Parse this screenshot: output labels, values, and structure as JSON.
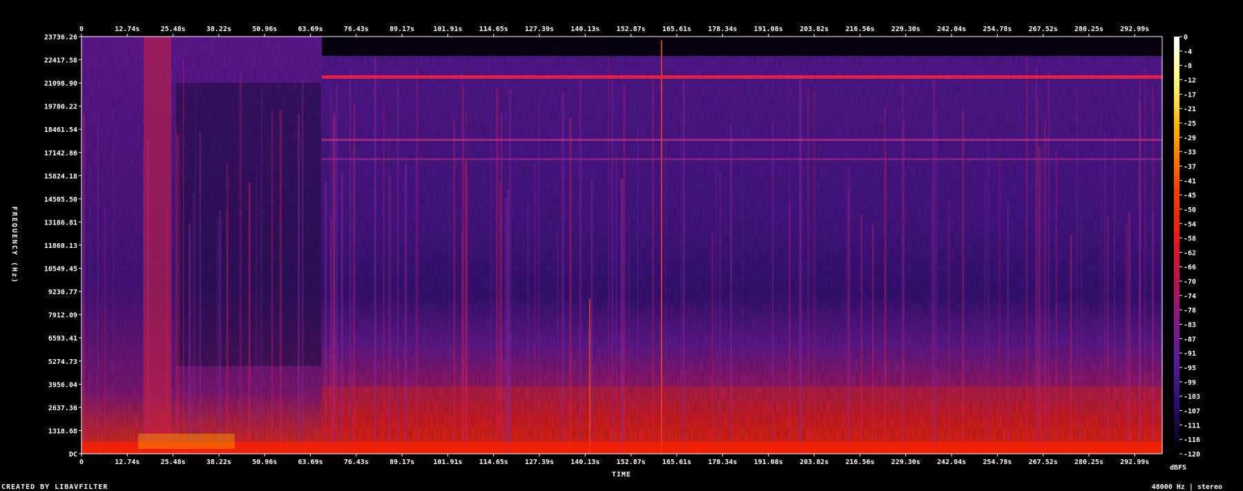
{
  "chart_data": {
    "type": "heatmap",
    "title": "",
    "xlabel": "TIME",
    "ylabel": "FREQUENCY (Hz)",
    "x_ticks": [
      "0",
      "12.74s",
      "25.48s",
      "38.22s",
      "50.96s",
      "63.69s",
      "76.43s",
      "89.17s",
      "101.91s",
      "114.65s",
      "127.39s",
      "140.13s",
      "152.87s",
      "165.61s",
      "178.34s",
      "191.08s",
      "203.82s",
      "216.56s",
      "229.30s",
      "242.04s",
      "254.78s",
      "267.52s",
      "280.25s",
      "292.99s"
    ],
    "y_ticks": [
      "23736.26",
      "22417.58",
      "21098.90",
      "19780.22",
      "18461.54",
      "17142.86",
      "15824.18",
      "14505.50",
      "13186.81",
      "11868.13",
      "10549.45",
      "9230.77",
      "7912.09",
      "6593.41",
      "5274.73",
      "3956.04",
      "2637.36",
      "1318.68",
      "DC"
    ],
    "colorbar_label": "dBFS",
    "colorbar_ticks": [
      "0",
      "-4",
      "-8",
      "-12",
      "-17",
      "-21",
      "-25",
      "-29",
      "-33",
      "-37",
      "-41",
      "-45",
      "-50",
      "-54",
      "-58",
      "-62",
      "-66",
      "-70",
      "-74",
      "-78",
      "-83",
      "-87",
      "-91",
      "-95",
      "-99",
      "-103",
      "-107",
      "-111",
      "-116",
      "-120"
    ],
    "colorbar_range": [
      -120,
      0
    ],
    "xlim": [
      0,
      300
    ],
    "ylim": [
      0,
      24000
    ],
    "colors": [
      "#000000",
      "#1a0a4a",
      "#3a1a8a",
      "#5a1a9a",
      "#8a1a8a",
      "#c0104a",
      "#e81818",
      "#ff5a00",
      "#ffb000",
      "#ffff80",
      "#ffffff"
    ]
  },
  "footer": {
    "left": "CREATED BY LIBAVFILTER",
    "right": "48000 Hz | stereo"
  }
}
